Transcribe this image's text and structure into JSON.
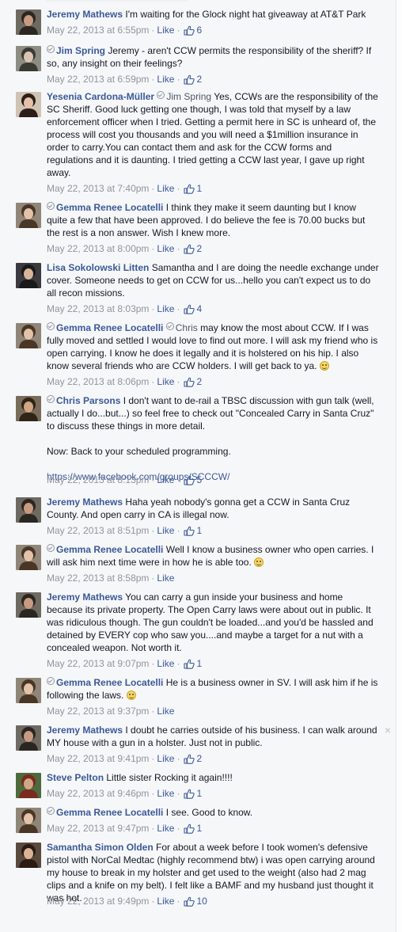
{
  "comments": [
    {
      "author": "Jeremy Mathews",
      "verified": false,
      "segments": [
        {
          "t": "I'm waiting for the Glock night hat giveaway at AT&T Park"
        }
      ],
      "timestamp": "May 22, 2013 at 6:55pm",
      "like_label": "Like",
      "likes": "6",
      "avatar": {
        "bg": "#6e6a62",
        "fg": "#2a2622",
        "skin": "#c89a80"
      }
    },
    {
      "author": "Jim Spring",
      "verified": true,
      "segments": [
        {
          "t": "Jeremy - aren't CCW permits the responsibility of the sheriff? If so, any insight on their feelings?"
        }
      ],
      "timestamp": "May 22, 2013 at 6:59pm",
      "like_label": "Like",
      "likes": "2",
      "avatar": {
        "bg": "#8c8c82",
        "fg": "#3a3a34",
        "skin": "#d8c4b0"
      }
    },
    {
      "author": "Yesenia Cardona-Müller",
      "verified": false,
      "segments": [
        {
          "t": "Jim Spring",
          "k": "mention",
          "v": true
        },
        {
          "t": " Yes, CCWs are the responsibility of the SC Sheriff. Good luck getting one though, I was told that myself by a law enforcement officer when I tried. Getting a permit here in SC is unheard of, the process will cost you thousands and you will need a $1million insurance in order to carry.You can contact them and ask for the CCW forms and regulations and it is daunting. I tried getting a CCW last year, I gave up right away."
        }
      ],
      "timestamp": "May 22, 2013 at 7:40pm",
      "like_label": "Like",
      "likes": "1",
      "avatar": {
        "bg": "#cfc3b4",
        "fg": "#2d1e18",
        "skin": "#e6c0a8"
      }
    },
    {
      "author": "Gemma Renee Locatelli",
      "verified": true,
      "segments": [
        {
          "t": "I think they make it seem daunting but I know quite a few that have been approved. I do believe the fee is 70.00 bucks but the rest is a non answer. Wish I knew more."
        }
      ],
      "timestamp": "May 22, 2013 at 8:00pm",
      "like_label": "Like",
      "likes": "2",
      "avatar": {
        "bg": "#8f8678",
        "fg": "#4a3626",
        "skin": "#e2c2a8"
      }
    },
    {
      "author": "Lisa Sokolowski Litten",
      "verified": false,
      "segments": [
        {
          "t": "Samantha and I are doing the needle exchange under cover. Someone needs to get on CCW for us...hello you can't expect us to do all recon missions."
        }
      ],
      "timestamp": "May 22, 2013 at 8:03pm",
      "like_label": "Like",
      "likes": "4",
      "avatar": {
        "bg": "#3c3a3e",
        "fg": "#1a1a1a",
        "skin": "#d9b49a"
      }
    },
    {
      "author": "Gemma Renee Locatelli",
      "verified": true,
      "segments": [
        {
          "t": "Chris",
          "k": "mention",
          "v": true
        },
        {
          "t": " may know the most about CCW. If I was fully moved and settled I would love to find out more. I will ask my friend who is open carrying. I know he does it legally and it is holstered on his hip. I also know several friends who are CCW holders. I will get back to ya. "
        },
        {
          "k": "smiley"
        }
      ],
      "timestamp": "May 22, 2013 at 8:06pm",
      "like_label": "Like",
      "likes": "2",
      "avatar": {
        "bg": "#8f8678",
        "fg": "#4a3626",
        "skin": "#e2c2a8"
      }
    },
    {
      "author": "Chris Parsons",
      "verified": true,
      "segments": [
        {
          "t": "I don't want to de-rail a TBSC discussion with gun talk (well, actually I do...but...) so feel free to check out \"Concealed Carry in Santa Cruz\" to discuss these things in more detail."
        },
        {
          "k": "br"
        },
        {
          "k": "br"
        },
        {
          "t": "Now: Back to your scheduled programming."
        },
        {
          "k": "br"
        },
        {
          "k": "br"
        },
        {
          "t": "https://www.facebook.com/groups/SCCCW/",
          "k": "link"
        }
      ],
      "timestamp": "May 22, 2013 at 8:13pm",
      "like_label": "Like",
      "likes": "5",
      "avatar": {
        "bg": "#7a6c5a",
        "fg": "#2e2418",
        "skin": "#cfa584"
      }
    },
    {
      "author": "Jeremy Mathews",
      "verified": false,
      "segments": [
        {
          "t": "Haha yeah nobody's gonna get a CCW in Santa Cruz County. And open carry in CA is illegal now."
        }
      ],
      "timestamp": "May 22, 2013 at 8:51pm",
      "like_label": "Like",
      "likes": "1",
      "avatar": {
        "bg": "#6e6a62",
        "fg": "#2a2622",
        "skin": "#c89a80"
      }
    },
    {
      "author": "Gemma Renee Locatelli",
      "verified": true,
      "segments": [
        {
          "t": "Well I know a business owner who open carries. I will ask him next time were in how he is able too. "
        },
        {
          "k": "smiley"
        }
      ],
      "timestamp": "May 22, 2013 at 8:58pm",
      "like_label": "Like",
      "likes": "",
      "avatar": {
        "bg": "#8f8678",
        "fg": "#4a3626",
        "skin": "#e2c2a8"
      }
    },
    {
      "author": "Jeremy Mathews",
      "verified": false,
      "segments": [
        {
          "t": "You can carry a gun inside your business and home because its private property. The Open Carry laws were about out in public. It was ridiculous though. The gun couldn't be loaded...and you'd be hassled and detained by EVERY cop who saw you....and maybe a target for a nut with a concealed weapon. Not worth it."
        }
      ],
      "timestamp": "May 22, 2013 at 9:07pm",
      "like_label": "Like",
      "likes": "1",
      "avatar": {
        "bg": "#6e6a62",
        "fg": "#2a2622",
        "skin": "#c89a80"
      }
    },
    {
      "author": "Gemma Renee Locatelli",
      "verified": true,
      "segments": [
        {
          "t": "He is a business owner in SV. I will ask him if he is following the laws. "
        },
        {
          "k": "smiley"
        }
      ],
      "timestamp": "May 22, 2013 at 9:37pm",
      "like_label": "Like",
      "likes": "",
      "avatar": {
        "bg": "#8f8678",
        "fg": "#4a3626",
        "skin": "#e2c2a8"
      }
    },
    {
      "author": "Jeremy Mathews",
      "verified": false,
      "has_close": true,
      "segments": [
        {
          "t": "I doubt he carries outside of his business. I can walk around MY house with a gun in a holster. Just not in public."
        }
      ],
      "timestamp": "May 22, 2013 at 9:41pm",
      "like_label": "Like",
      "likes": "2",
      "avatar": {
        "bg": "#6e6a62",
        "fg": "#2a2622",
        "skin": "#c89a80"
      }
    },
    {
      "author": "Steve Pelton",
      "verified": false,
      "segments": [
        {
          "t": "Little sister Rocking it again!!!!"
        }
      ],
      "timestamp": "May 22, 2013 at 9:46pm",
      "like_label": "Like",
      "likes": "1",
      "avatar": {
        "bg": "#4e6a3c",
        "fg": "#7a2a1e",
        "skin": "#d0a888"
      }
    },
    {
      "author": "Gemma Renee Locatelli",
      "verified": true,
      "segments": [
        {
          "t": "I see. Good to know."
        }
      ],
      "timestamp": "May 22, 2013 at 9:47pm",
      "like_label": "Like",
      "likes": "1",
      "avatar": {
        "bg": "#8f8678",
        "fg": "#4a3626",
        "skin": "#e2c2a8"
      }
    },
    {
      "author": "Samantha Simon Olden",
      "verified": false,
      "segments": [
        {
          "t": "For about a week before I took women's defensive pistol with NorCal Medtac (highly recommend btw) i was open carrying around my house to break in my holster and get used to the weight (also had 2 mag clips and a knife on my belt). I felt like a BAMF and my husband just thought it was hot."
        }
      ],
      "timestamp": "May 22, 2013 at 9:49pm",
      "like_label": "Like",
      "likes": "10",
      "avatar": {
        "bg": "#5a4a3e",
        "fg": "#2a1c14",
        "skin": "#dcb294"
      }
    }
  ],
  "colors": {
    "link": "#3b5998",
    "meta": "#90949c",
    "text": "#141823",
    "background": "#f6f7f9"
  },
  "icons": {
    "like_count": "thumbs-up-icon",
    "verified": "verified-badge-icon",
    "dismiss": "close-icon",
    "emoticon": "smiley-icon"
  }
}
